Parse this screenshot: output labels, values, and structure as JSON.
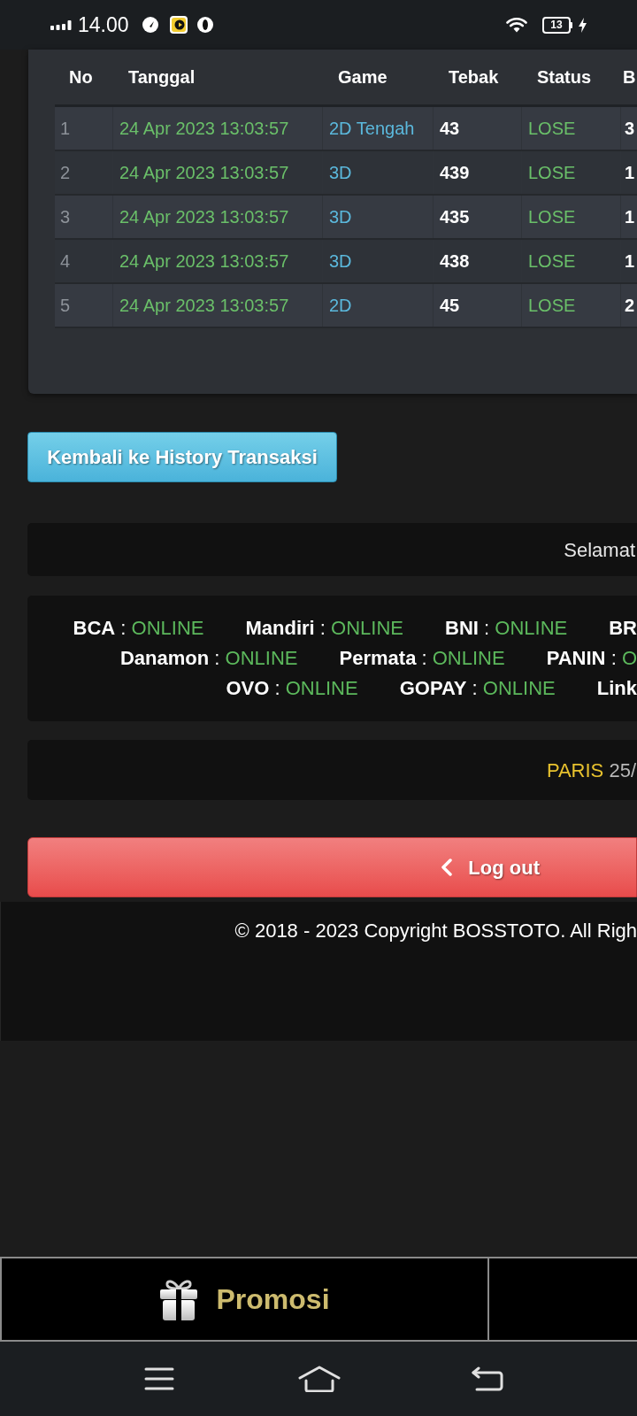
{
  "status_bar": {
    "time": "14.00",
    "battery": "13"
  },
  "table": {
    "columns": [
      "No",
      "Tanggal",
      "Game",
      "Tebak",
      "Status",
      "B"
    ],
    "rows": [
      {
        "no": "1",
        "tanggal": "24 Apr 2023 13:03:57",
        "game": "2D Tengah",
        "tebak": "43",
        "status": "LOSE",
        "column_6": "3"
      },
      {
        "no": "2",
        "tanggal": "24 Apr 2023 13:03:57",
        "game": "3D",
        "tebak": "439",
        "status": "LOSE",
        "column_6": "1"
      },
      {
        "no": "3",
        "tanggal": "24 Apr 2023 13:03:57",
        "game": "3D",
        "tebak": "435",
        "status": "LOSE",
        "column_6": "1"
      },
      {
        "no": "4",
        "tanggal": "24 Apr 2023 13:03:57",
        "game": "3D",
        "tebak": "438",
        "status": "LOSE",
        "column_6": "1"
      },
      {
        "no": "5",
        "tanggal": "24 Apr 2023 13:03:57",
        "game": "2D",
        "tebak": "45",
        "status": "LOSE",
        "column_6": "2"
      }
    ]
  },
  "back_button": {
    "label": "Kembali ke History Transaksi"
  },
  "announcement": {
    "text": "Selamat"
  },
  "bank_status": {
    "lines": [
      [
        {
          "name": "BCA",
          "separator": ":",
          "status": "ONLINE"
        },
        {
          "name": "Mandiri",
          "separator": ":",
          "status": "ONLINE"
        },
        {
          "name": "BNI",
          "separator": ":",
          "status": "ONLINE"
        },
        {
          "name": "BR"
        }
      ],
      [
        {
          "name": "Danamon",
          "separator": ":",
          "status": "ONLINE"
        },
        {
          "name": "Permata",
          "separator": ":",
          "status": "ONLINE"
        },
        {
          "name": "PANIN",
          "separator": ":",
          "status": "O"
        }
      ],
      [
        {
          "name": "OVO",
          "separator": ":",
          "status": "ONLINE"
        },
        {
          "name": "GOPAY",
          "separator": ":",
          "status": "ONLINE"
        },
        {
          "name": "Link"
        }
      ]
    ]
  },
  "result_ticker": {
    "market": "PARIS",
    "date": "25/"
  },
  "logout_button": {
    "label": "Log out"
  },
  "footer": {
    "copyright": "© 2018 - 2023 Copyright BOSSTOTO. All Righ"
  },
  "bottom_nav": [
    {
      "label": "Promosi"
    }
  ]
}
